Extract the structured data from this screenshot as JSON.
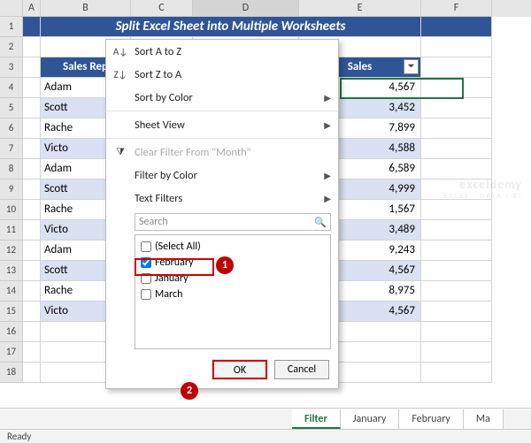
{
  "columns": [
    "A",
    "B",
    "C",
    "D",
    "E",
    "F"
  ],
  "title": "Split Excel Sheet into Multiple Worksheets",
  "headers": {
    "b": "Sales Rep",
    "e": "Sales"
  },
  "rows": [
    {
      "n": "1"
    },
    {
      "n": "2"
    },
    {
      "n": "3"
    },
    {
      "n": "4",
      "rep": "Adam",
      "sales": "4,567",
      "band": "odd"
    },
    {
      "n": "5",
      "rep": "Scott",
      "sales": "3,452",
      "band": "even"
    },
    {
      "n": "6",
      "rep": "Rache",
      "sales": "7,899",
      "band": "odd"
    },
    {
      "n": "7",
      "rep": "Victo",
      "sales": "4,588",
      "band": "even"
    },
    {
      "n": "8",
      "rep": "Adam",
      "sales": "6,589",
      "band": "odd"
    },
    {
      "n": "9",
      "rep": "Scott",
      "sales": "4,999",
      "band": "even"
    },
    {
      "n": "10",
      "rep": "Rache",
      "sales": "1,567",
      "band": "odd"
    },
    {
      "n": "11",
      "rep": "Victo",
      "sales": "3,489",
      "band": "even"
    },
    {
      "n": "12",
      "rep": "Adam",
      "sales": "9,243",
      "band": "odd"
    },
    {
      "n": "13",
      "rep": "Scott",
      "sales": "4,567",
      "band": "even"
    },
    {
      "n": "14",
      "rep": "Rache",
      "sales": "8,975",
      "band": "odd"
    },
    {
      "n": "15",
      "rep": "Victo",
      "sales": "4,567",
      "band": "even"
    },
    {
      "n": "16"
    },
    {
      "n": "17"
    },
    {
      "n": "18"
    }
  ],
  "currency": "$",
  "menu": {
    "sort_az": "Sort A to Z",
    "sort_za": "Sort Z to A",
    "sort_color": "Sort by Color",
    "sheet_view": "Sheet View",
    "clear_filter": "Clear Filter From \"Month\"",
    "filter_color": "Filter by Color",
    "text_filters": "Text Filters",
    "search_ph": "Search",
    "opts": {
      "select_all": "(Select All)",
      "feb": "February",
      "jan": "January",
      "mar": "March"
    },
    "ok": "OK",
    "cancel": "Cancel"
  },
  "callouts": {
    "one": "1",
    "two": "2"
  },
  "tabs": [
    "Filter",
    "January",
    "February",
    "Ma"
  ],
  "status": "Ready",
  "watermark": {
    "big": "exceldemy",
    "small": "EXCEL · DATA · BI"
  }
}
